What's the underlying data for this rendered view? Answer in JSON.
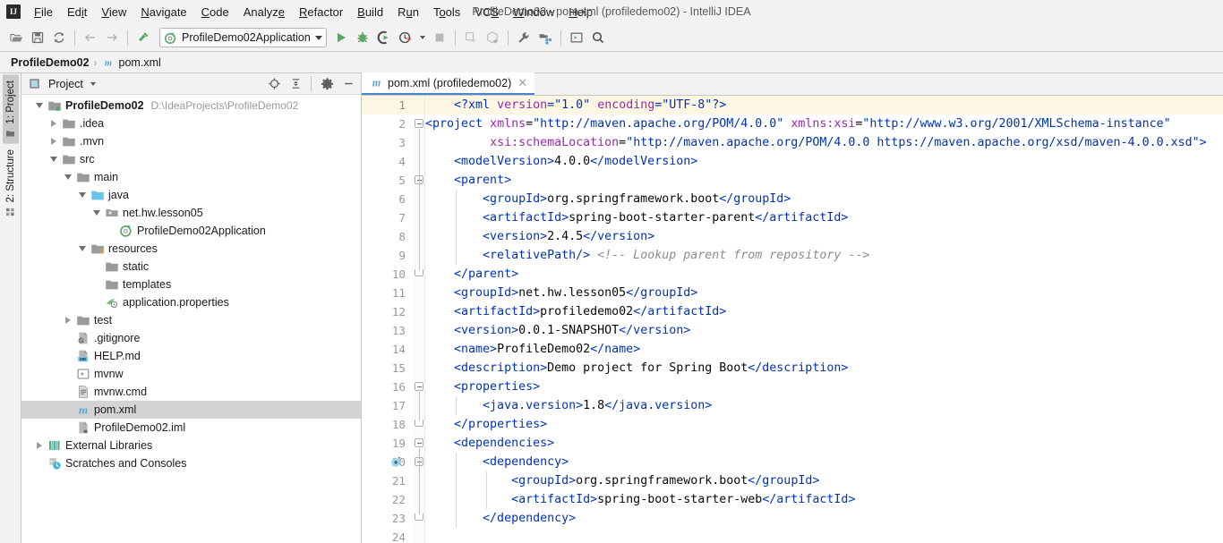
{
  "window": {
    "title": "ProfileDemo02 - pom.xml (profiledemo02) - IntelliJ IDEA",
    "logo": "IJ"
  },
  "menu": {
    "items": [
      {
        "label": "File",
        "icon": "menu-file"
      },
      {
        "label": "Edit",
        "icon": "menu-edit"
      },
      {
        "label": "View",
        "icon": "menu-view"
      },
      {
        "label": "Navigate",
        "icon": "menu-navigate"
      },
      {
        "label": "Code",
        "icon": "menu-code"
      },
      {
        "label": "Analyze",
        "icon": "menu-analyze"
      },
      {
        "label": "Refactor",
        "icon": "menu-refactor"
      },
      {
        "label": "Build",
        "icon": "menu-build"
      },
      {
        "label": "Run",
        "icon": "menu-run"
      },
      {
        "label": "Tools",
        "icon": "menu-tools"
      },
      {
        "label": "VCS",
        "icon": "menu-vcs"
      },
      {
        "label": "Window",
        "icon": "menu-window"
      },
      {
        "label": "Help",
        "icon": "menu-help"
      }
    ]
  },
  "toolbar": {
    "run_configuration": "ProfileDemo02Application",
    "icons": [
      "open-folder-icon",
      "save-all-icon",
      "sync-icon",
      "back-arrow-icon",
      "forward-arrow-icon",
      "build-hammer-icon"
    ],
    "run_icons": [
      "run-icon",
      "debug-icon",
      "run-with-coverage-icon",
      "profile-icon",
      "stop-icon",
      "update-app-icon",
      "rerun-tests-icon",
      "settings-wrench-icon",
      "project-structure-icon",
      "console-icon",
      "search-everywhere-icon"
    ]
  },
  "breadcrumb": {
    "project": "ProfileDemo02",
    "separator": "›",
    "file": "pom.xml",
    "file_icon": "maven-m-icon"
  },
  "tool_tabs": [
    {
      "label": "1: Project",
      "icon": "project-folder-icon",
      "active": true
    },
    {
      "label": "2: Structure",
      "icon": "structure-icon",
      "active": false
    }
  ],
  "project_panel": {
    "title": "Project",
    "header_icons": [
      "locate-target-icon",
      "collapse-all-icon",
      "settings-gear-icon",
      "minimize-icon"
    ],
    "tree": [
      {
        "label": "ProfileDemo02",
        "path": "D:\\IdeaProjects\\ProfileDemo02",
        "indent": 0,
        "twisty": "down",
        "icon": "module-folder-icon",
        "bold": true,
        "selected": false
      },
      {
        "label": ".idea",
        "path": "",
        "indent": 1,
        "twisty": "right",
        "icon": "folder-icon",
        "bold": false,
        "selected": false
      },
      {
        "label": ".mvn",
        "path": "",
        "indent": 1,
        "twisty": "right",
        "icon": "folder-icon",
        "bold": false,
        "selected": false
      },
      {
        "label": "src",
        "path": "",
        "indent": 1,
        "twisty": "down",
        "icon": "folder-icon",
        "bold": false,
        "selected": false
      },
      {
        "label": "main",
        "path": "",
        "indent": 2,
        "twisty": "down",
        "icon": "folder-icon",
        "bold": false,
        "selected": false
      },
      {
        "label": "java",
        "path": "",
        "indent": 3,
        "twisty": "down",
        "icon": "source-root-icon",
        "bold": false,
        "selected": false
      },
      {
        "label": "net.hw.lesson05",
        "path": "",
        "indent": 4,
        "twisty": "down",
        "icon": "package-icon",
        "bold": false,
        "selected": false
      },
      {
        "label": "ProfileDemo02Application",
        "path": "",
        "indent": 5,
        "twisty": "none",
        "icon": "spring-class-icon",
        "bold": false,
        "selected": false
      },
      {
        "label": "resources",
        "path": "",
        "indent": 3,
        "twisty": "down",
        "icon": "resource-root-icon",
        "bold": false,
        "selected": false
      },
      {
        "label": "static",
        "path": "",
        "indent": 4,
        "twisty": "none",
        "icon": "folder-icon",
        "bold": false,
        "selected": false
      },
      {
        "label": "templates",
        "path": "",
        "indent": 4,
        "twisty": "none",
        "icon": "folder-icon",
        "bold": false,
        "selected": false
      },
      {
        "label": "application.properties",
        "path": "",
        "indent": 4,
        "twisty": "none",
        "icon": "spring-properties-icon",
        "bold": false,
        "selected": false
      },
      {
        "label": "test",
        "path": "",
        "indent": 2,
        "twisty": "right",
        "icon": "folder-icon",
        "bold": false,
        "selected": false
      },
      {
        "label": ".gitignore",
        "path": "",
        "indent": 2,
        "twisty": "none",
        "icon": "gitignore-file-icon",
        "bold": false,
        "selected": false
      },
      {
        "label": "HELP.md",
        "path": "",
        "indent": 2,
        "twisty": "none",
        "icon": "markdown-file-icon",
        "bold": false,
        "selected": false
      },
      {
        "label": "mvnw",
        "path": "",
        "indent": 2,
        "twisty": "none",
        "icon": "shell-script-icon",
        "bold": false,
        "selected": false
      },
      {
        "label": "mvnw.cmd",
        "path": "",
        "indent": 2,
        "twisty": "none",
        "icon": "cmd-script-icon",
        "bold": false,
        "selected": false
      },
      {
        "label": "pom.xml",
        "path": "",
        "indent": 2,
        "twisty": "none",
        "icon": "maven-m-icon",
        "bold": false,
        "selected": true
      },
      {
        "label": "ProfileDemo02.iml",
        "path": "",
        "indent": 2,
        "twisty": "none",
        "icon": "iml-file-icon",
        "bold": false,
        "selected": false
      },
      {
        "label": "External Libraries",
        "path": "",
        "indent": 0,
        "twisty": "right",
        "icon": "libraries-icon",
        "bold": false,
        "selected": false
      },
      {
        "label": "Scratches and Consoles",
        "path": "",
        "indent": 0,
        "twisty": "none",
        "icon": "scratches-icon",
        "bold": false,
        "selected": false
      }
    ]
  },
  "editor": {
    "tabs": [
      {
        "label": "pom.xml (profiledemo02)",
        "icon": "maven-m-icon",
        "active": true,
        "close_icon": "close-icon"
      }
    ],
    "caret_line": 1,
    "gutter_marker_line": 20,
    "gutter_marker_icon": "spring-bean-gutter-icon",
    "first_line": 1,
    "last_line": 24,
    "lines": [
      {
        "n": 1,
        "fold": "none",
        "tokens": [
          {
            "t": "pi",
            "s": "<?xml "
          },
          {
            "t": "attr",
            "s": "version"
          },
          {
            "t": "pi",
            "s": "="
          },
          {
            "t": "val",
            "s": "\"1.0\""
          },
          {
            "t": "pi",
            "s": " "
          },
          {
            "t": "attr",
            "s": "encoding"
          },
          {
            "t": "pi",
            "s": "="
          },
          {
            "t": "val",
            "s": "\"UTF-8\""
          },
          {
            "t": "pi",
            "s": "?>"
          }
        ],
        "indent": "    "
      },
      {
        "n": 2,
        "fold": "start",
        "tokens": [
          {
            "t": "tag",
            "s": "<project "
          },
          {
            "t": "attr",
            "s": "xmlns"
          },
          {
            "t": "txt",
            "s": "="
          },
          {
            "t": "val",
            "s": "\"http://maven.apache.org/POM/4.0.0\""
          },
          {
            "t": "txt",
            "s": " "
          },
          {
            "t": "attr",
            "s": "xmlns:xsi"
          },
          {
            "t": "txt",
            "s": "="
          },
          {
            "t": "val",
            "s": "\"http://www.w3.org/2001/XMLSchema-instance\""
          }
        ],
        "indent": ""
      },
      {
        "n": 3,
        "fold": "none",
        "tokens": [
          {
            "t": "attr",
            "s": "xsi:schemaLocation"
          },
          {
            "t": "txt",
            "s": "="
          },
          {
            "t": "val",
            "s": "\"http://maven.apache.org/POM/4.0.0 https://maven.apache.org/xsd/maven-4.0.0.xsd\""
          },
          {
            "t": "tag",
            "s": ">"
          }
        ],
        "indent": "         "
      },
      {
        "n": 4,
        "fold": "none",
        "tokens": [
          {
            "t": "tag",
            "s": "<modelVersion>"
          },
          {
            "t": "txt",
            "s": "4.0.0"
          },
          {
            "t": "tag",
            "s": "</modelVersion>"
          }
        ],
        "indent": "    "
      },
      {
        "n": 5,
        "fold": "start",
        "tokens": [
          {
            "t": "tag",
            "s": "<parent>"
          }
        ],
        "indent": "    "
      },
      {
        "n": 6,
        "fold": "none",
        "tokens": [
          {
            "t": "tag",
            "s": "<groupId>"
          },
          {
            "t": "txt",
            "s": "org.springframework.boot"
          },
          {
            "t": "tag",
            "s": "</groupId>"
          }
        ],
        "indent": "        "
      },
      {
        "n": 7,
        "fold": "none",
        "tokens": [
          {
            "t": "tag",
            "s": "<artifactId>"
          },
          {
            "t": "txt",
            "s": "spring-boot-starter-parent"
          },
          {
            "t": "tag",
            "s": "</artifactId>"
          }
        ],
        "indent": "        "
      },
      {
        "n": 8,
        "fold": "none",
        "tokens": [
          {
            "t": "tag",
            "s": "<version>"
          },
          {
            "t": "txt",
            "s": "2.4.5"
          },
          {
            "t": "tag",
            "s": "</version>"
          }
        ],
        "indent": "        "
      },
      {
        "n": 9,
        "fold": "none",
        "tokens": [
          {
            "t": "tag",
            "s": "<relativePath/>"
          },
          {
            "t": "txt",
            "s": " "
          },
          {
            "t": "cmt",
            "s": "<!-- Lookup parent from repository -->"
          }
        ],
        "indent": "        "
      },
      {
        "n": 10,
        "fold": "end",
        "tokens": [
          {
            "t": "tag",
            "s": "</parent>"
          }
        ],
        "indent": "    "
      },
      {
        "n": 11,
        "fold": "none",
        "tokens": [
          {
            "t": "tag",
            "s": "<groupId>"
          },
          {
            "t": "txt",
            "s": "net.hw.lesson05"
          },
          {
            "t": "tag",
            "s": "</groupId>"
          }
        ],
        "indent": "    "
      },
      {
        "n": 12,
        "fold": "none",
        "tokens": [
          {
            "t": "tag",
            "s": "<artifactId>"
          },
          {
            "t": "txt",
            "s": "profiledemo02"
          },
          {
            "t": "tag",
            "s": "</artifactId>"
          }
        ],
        "indent": "    "
      },
      {
        "n": 13,
        "fold": "none",
        "tokens": [
          {
            "t": "tag",
            "s": "<version>"
          },
          {
            "t": "txt",
            "s": "0.0.1-SNAPSHOT"
          },
          {
            "t": "tag",
            "s": "</version>"
          }
        ],
        "indent": "    "
      },
      {
        "n": 14,
        "fold": "none",
        "tokens": [
          {
            "t": "tag",
            "s": "<name>"
          },
          {
            "t": "txt",
            "s": "ProfileDemo02"
          },
          {
            "t": "tag",
            "s": "</name>"
          }
        ],
        "indent": "    "
      },
      {
        "n": 15,
        "fold": "none",
        "tokens": [
          {
            "t": "tag",
            "s": "<description>"
          },
          {
            "t": "txt",
            "s": "Demo project for Spring Boot"
          },
          {
            "t": "tag",
            "s": "</description>"
          }
        ],
        "indent": "    "
      },
      {
        "n": 16,
        "fold": "start",
        "tokens": [
          {
            "t": "tag",
            "s": "<properties>"
          }
        ],
        "indent": "    "
      },
      {
        "n": 17,
        "fold": "none",
        "tokens": [
          {
            "t": "tag",
            "s": "<java.version>"
          },
          {
            "t": "txt",
            "s": "1.8"
          },
          {
            "t": "tag",
            "s": "</java.version>"
          }
        ],
        "indent": "        "
      },
      {
        "n": 18,
        "fold": "end",
        "tokens": [
          {
            "t": "tag",
            "s": "</properties>"
          }
        ],
        "indent": "    "
      },
      {
        "n": 19,
        "fold": "start",
        "tokens": [
          {
            "t": "tag",
            "s": "<dependencies>"
          }
        ],
        "indent": "    "
      },
      {
        "n": 20,
        "fold": "start",
        "tokens": [
          {
            "t": "tag",
            "s": "<dependency>"
          }
        ],
        "indent": "        "
      },
      {
        "n": 21,
        "fold": "none",
        "tokens": [
          {
            "t": "tag",
            "s": "<groupId>"
          },
          {
            "t": "txt",
            "s": "org.springframework.boot"
          },
          {
            "t": "tag",
            "s": "</groupId>"
          }
        ],
        "indent": "            "
      },
      {
        "n": 22,
        "fold": "none",
        "tokens": [
          {
            "t": "tag",
            "s": "<artifactId>"
          },
          {
            "t": "txt",
            "s": "spring-boot-starter-web"
          },
          {
            "t": "tag",
            "s": "</artifactId>"
          }
        ],
        "indent": "            "
      },
      {
        "n": 23,
        "fold": "end",
        "tokens": [
          {
            "t": "tag",
            "s": "</dependency>"
          }
        ],
        "indent": "        "
      },
      {
        "n": 24,
        "fold": "none",
        "tokens": [],
        "indent": ""
      }
    ]
  },
  "colors": {
    "chrome": "#f2f2f2",
    "tag": "#0033b3",
    "attribute": "#9c27b0",
    "comment": "#8c8c8c",
    "selection": "#d4d4d4",
    "caret_line": "#fdf6e3",
    "tab_underline": "#4a86c8",
    "maven_icon": "#56a8d8",
    "run_green": "#59a869"
  }
}
